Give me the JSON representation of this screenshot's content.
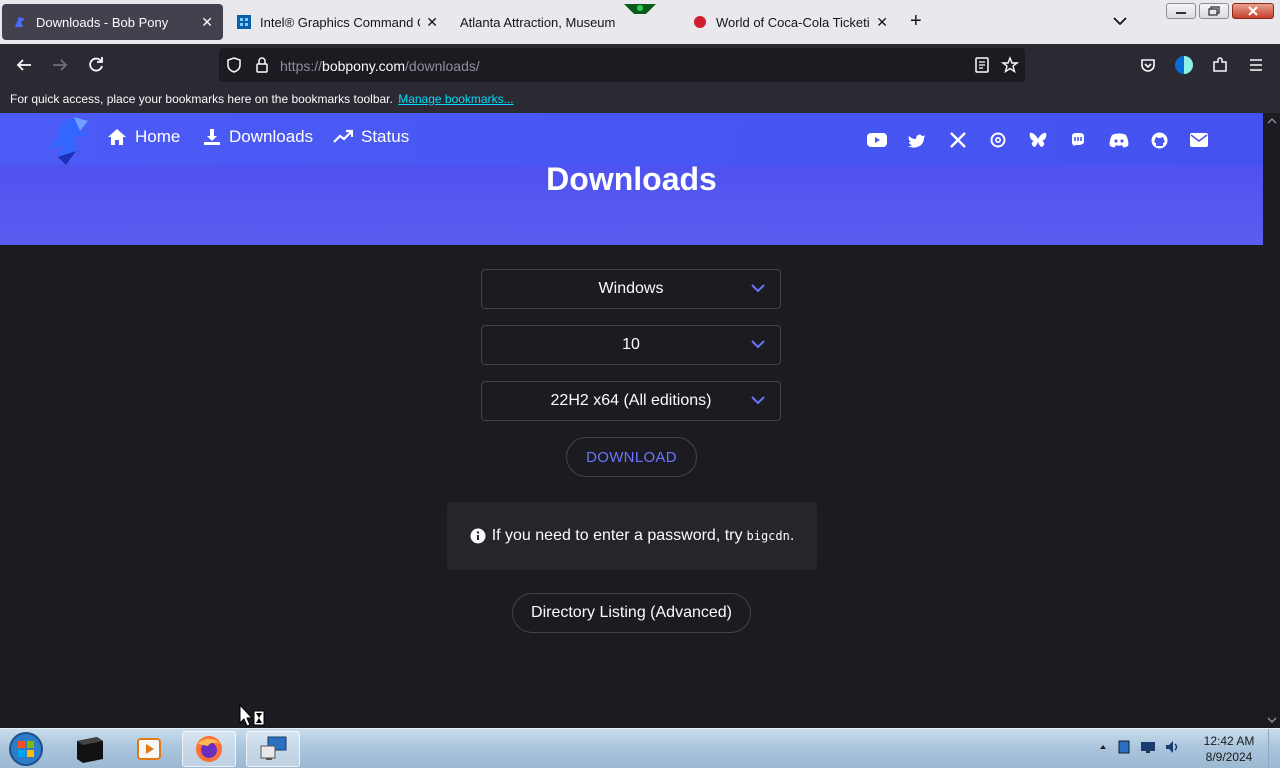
{
  "browser": {
    "tabs": [
      {
        "title": "Downloads - Bob Pony",
        "active": true
      },
      {
        "title": "Intel® Graphics Command Cen",
        "active": false
      },
      {
        "title": "Atlanta Attraction, Museum",
        "active": false
      },
      {
        "title": "World of Coca-Cola Ticketing S",
        "active": false
      }
    ],
    "url_scheme": "https://",
    "url_host": "bobpony.com",
    "url_path": "/downloads/",
    "bookmarks_text": "For quick access, place your bookmarks here on the bookmarks toolbar.",
    "bookmarks_link": "Manage bookmarks..."
  },
  "site": {
    "nav": {
      "home": "Home",
      "downloads": "Downloads",
      "status": "Status"
    },
    "socials": [
      "youtube-icon",
      "twitter-icon",
      "x-icon",
      "threads-icon",
      "bluesky-icon",
      "mastodon-icon",
      "discord-icon",
      "github-icon",
      "email-icon"
    ],
    "heading": "Downloads",
    "selects": {
      "os": "Windows",
      "version": "10",
      "build": "22H2 x64 (All editions)"
    },
    "download_label": "DOWNLOAD",
    "info_text": "If you need to enter a password, try",
    "info_code": "bigcdn",
    "info_suffix": ".",
    "directory_label": "Directory Listing (Advanced)",
    "colors": {
      "accent": "#4b57f4",
      "link": "#6b76ff"
    }
  },
  "taskbar": {
    "time": "12:42 AM",
    "date": "8/9/2024"
  }
}
